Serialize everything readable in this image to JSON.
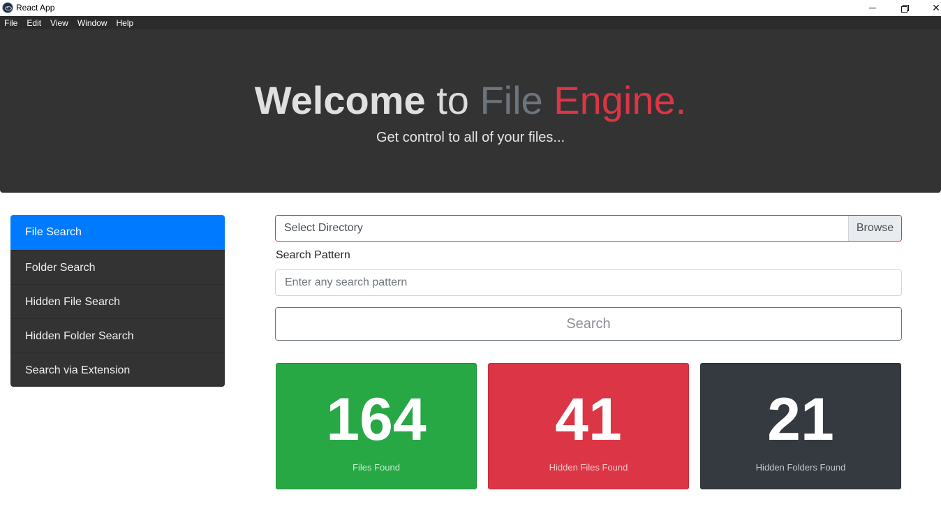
{
  "window": {
    "title": "React App",
    "minimize_glyph": "",
    "close_glyph": "✕"
  },
  "menu": [
    "File",
    "Edit",
    "View",
    "Window",
    "Help"
  ],
  "hero": {
    "welcome": "Welcome",
    "to": "to",
    "file": "File",
    "engine": "Engine.",
    "subtitle": "Get control to all of your files..."
  },
  "sidebar": {
    "items": [
      {
        "label": "File Search",
        "active": true
      },
      {
        "label": "Folder Search",
        "active": false
      },
      {
        "label": "Hidden File Search",
        "active": false
      },
      {
        "label": "Hidden Folder Search",
        "active": false
      },
      {
        "label": "Search via Extension",
        "active": false
      }
    ]
  },
  "form": {
    "directory_placeholder": "Select Directory",
    "browse_label": "Browse",
    "pattern_label": "Search Pattern",
    "pattern_placeholder": "Enter any search pattern",
    "search_label": "Search"
  },
  "stats": [
    {
      "value": "164",
      "label": "Files Found",
      "color": "#28a745"
    },
    {
      "value": "41",
      "label": "Hidden Files Found",
      "color": "#dc3545"
    },
    {
      "value": "21",
      "label": "Hidden Folders Found",
      "color": "#343a40"
    }
  ],
  "colors": {
    "primary": "#007bff",
    "danger": "#dc3545",
    "success": "#28a745",
    "dark": "#343a40",
    "hero_bg": "#333333"
  }
}
